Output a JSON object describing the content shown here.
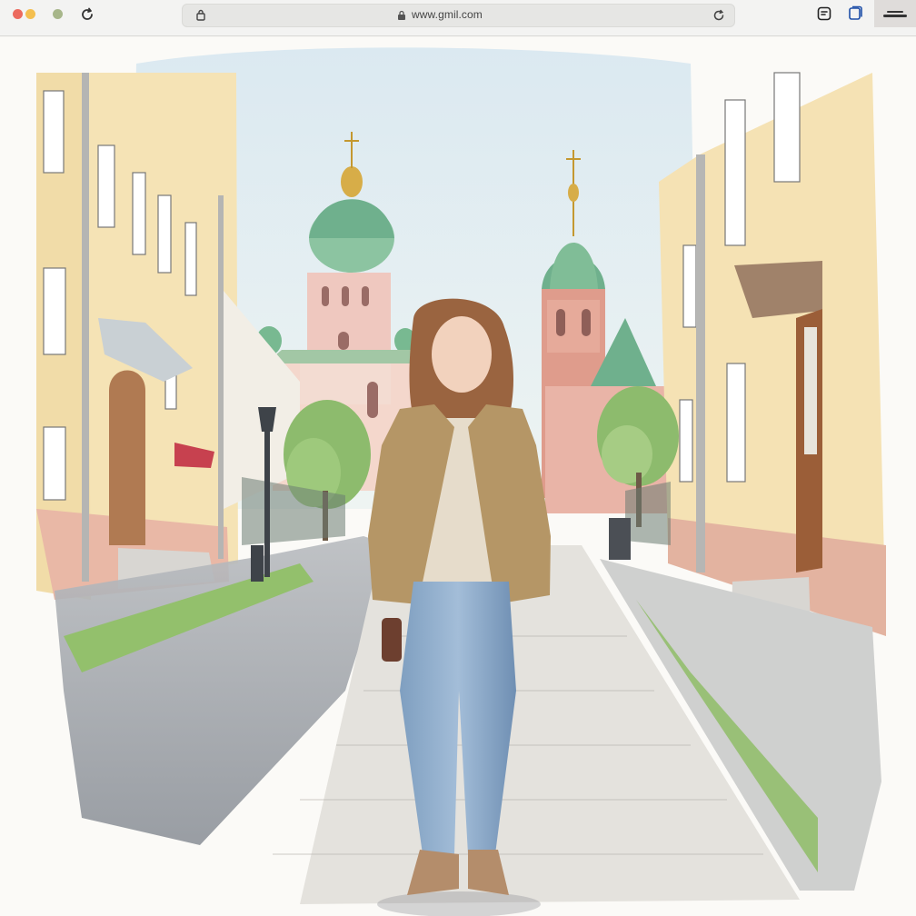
{
  "browser": {
    "url": "www.gmil.com",
    "icons": {
      "close": "close-dot",
      "minimize": "minimize-dot",
      "maximize": "maximize-dot",
      "reload": "reload-icon",
      "share": "share-icon",
      "tabs": "tabs-icon",
      "menu": "menu-icon",
      "lock": "lock-icon"
    },
    "colors": {
      "close": "#ec6a5e",
      "minimize": "#f4bf4f",
      "maximize": "#a7b68a"
    }
  },
  "page": {
    "image": {
      "name": "watercolor-street-illustration"
    }
  }
}
